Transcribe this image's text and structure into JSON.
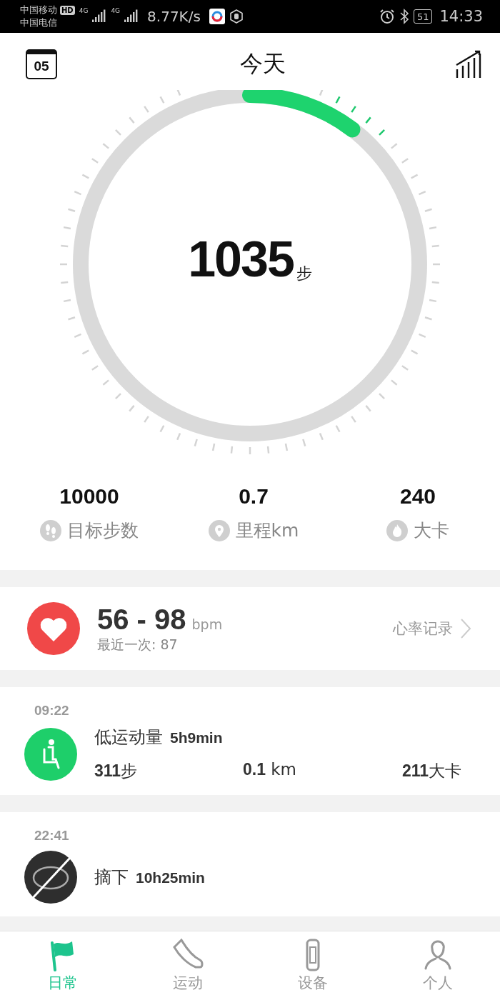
{
  "status_bar": {
    "carriers": [
      "中国移动",
      "中国电信"
    ],
    "hd": "HD",
    "networks": [
      "4G",
      "4G"
    ],
    "speed": "8.77K/s",
    "battery": "51",
    "time": "14:33"
  },
  "header": {
    "date": "05",
    "title": "今天"
  },
  "ring": {
    "steps": "1035",
    "unit": "步"
  },
  "stats": [
    {
      "kind": "steps",
      "value": "10000",
      "label": "目标步数"
    },
    {
      "kind": "distance",
      "value": "0.7",
      "label": "里程km"
    },
    {
      "kind": "calories",
      "value": "240",
      "label": "大卡"
    }
  ],
  "heart": {
    "range": "56 - 98",
    "unit": "bpm",
    "latest": "最近一次: 87",
    "link": "心率记录"
  },
  "activities": [
    {
      "kind": "sedentary",
      "time": "09:22",
      "title": "低运动量",
      "duration": "5h9min",
      "metrics": [
        {
          "value": "311",
          "unit": "步"
        },
        {
          "value": "0.1",
          "unit": " km"
        },
        {
          "value": "211",
          "unit": "大卡"
        }
      ]
    },
    {
      "kind": "off_wrist",
      "time": "22:41",
      "title": "摘下",
      "duration": "10h25min"
    }
  ],
  "tabs": [
    {
      "kind": "daily",
      "label": "日常",
      "selected": true
    },
    {
      "kind": "sport",
      "label": "运动",
      "selected": false
    },
    {
      "kind": "device",
      "label": "设备",
      "selected": false
    },
    {
      "kind": "profile",
      "label": "个人",
      "selected": false
    }
  ]
}
